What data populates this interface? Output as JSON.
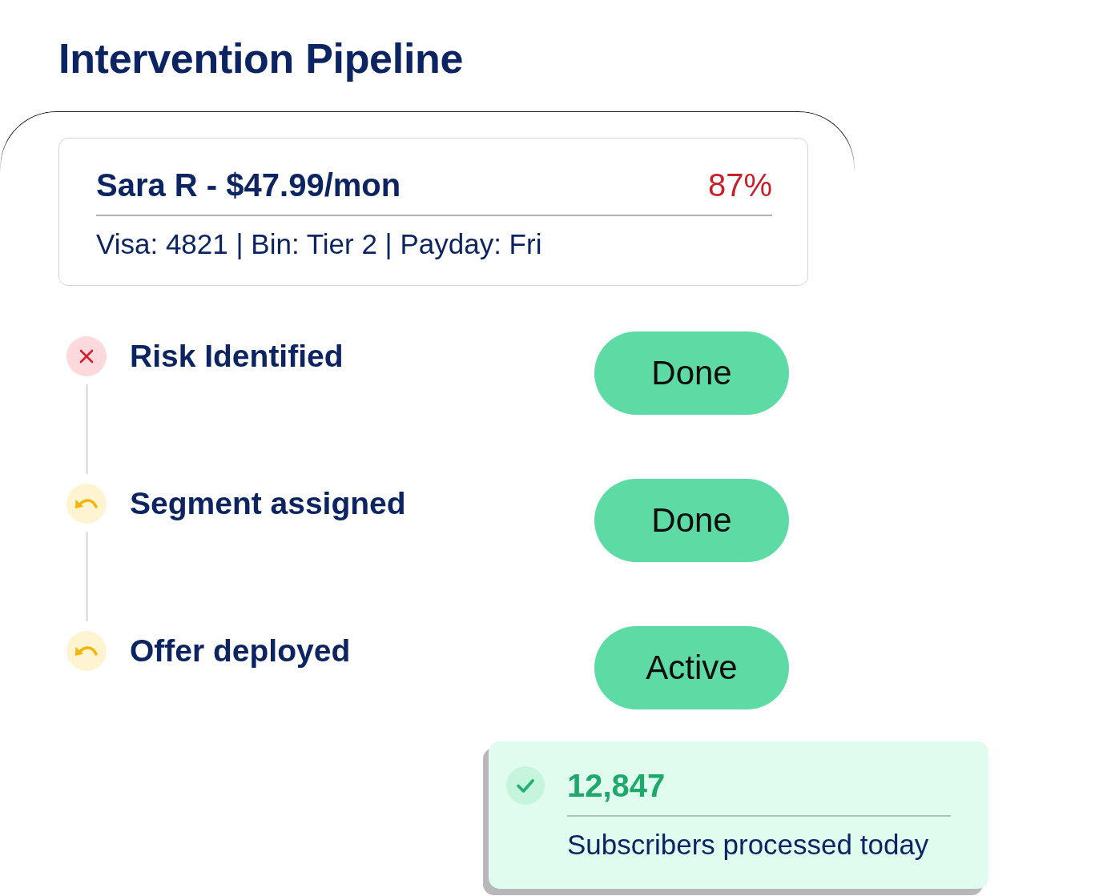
{
  "title": "Intervention Pipeline",
  "customer_card": {
    "name": "Sara R - $47.99/mon",
    "score": "87%",
    "details": "Visa: 4821 | Bin: Tier 2 | Payday: Fri"
  },
  "steps": [
    {
      "label": "Risk Identified",
      "kind": "alert",
      "status": "Done"
    },
    {
      "label": "Segment assigned",
      "kind": "pending",
      "status": "Done"
    },
    {
      "label": "Offer deployed",
      "kind": "pending",
      "status": "Active"
    }
  ],
  "summary": {
    "value": "12,847",
    "caption": "Subscribers processed today"
  }
}
